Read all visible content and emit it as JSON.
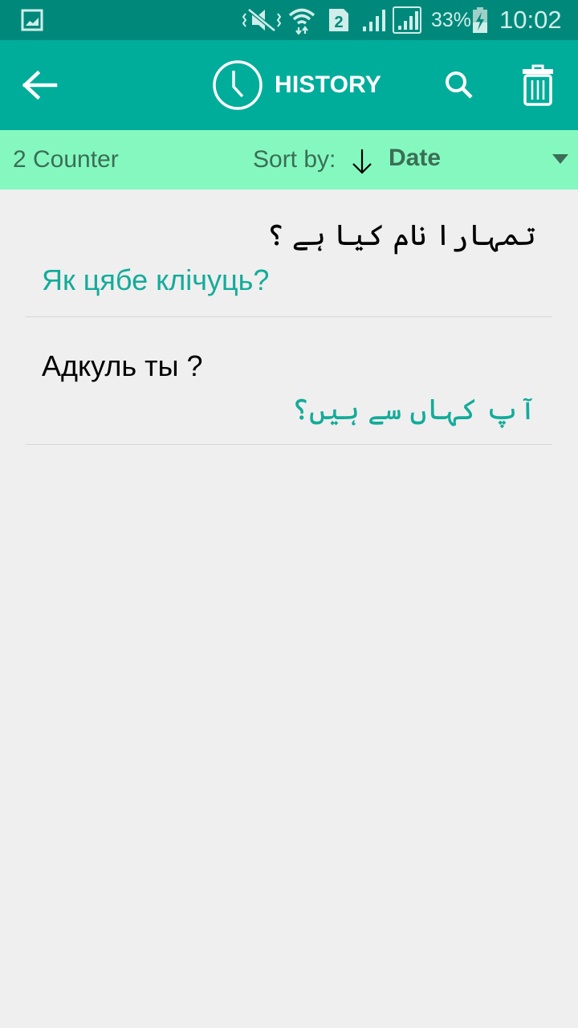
{
  "status_bar": {
    "battery": "33%",
    "time": "10:02",
    "sim": "2",
    "icons": [
      "gallery-icon",
      "vibrate-mute-icon",
      "wifi-icon",
      "sim2-icon",
      "signal-icon",
      "signal-icon",
      "battery-charging-icon"
    ]
  },
  "app_bar": {
    "title": "HISTORY",
    "back_icon": "arrow-left-icon",
    "title_icon": "clock-icon",
    "search_icon": "search-icon",
    "delete_icon": "trash-icon"
  },
  "sort_bar": {
    "counter": "2 Counter",
    "sort_label": "Sort by:",
    "sort_value": "Date",
    "sort_direction_icon": "arrow-down-icon"
  },
  "history": [
    {
      "source": "تمہارا نام کیا ہے ؟",
      "translation": "Як цябе клічуць?"
    },
    {
      "source": "Адкуль ты ?",
      "translation": "آپ کہاں سے ہیں؟"
    }
  ],
  "colors": {
    "status_bar": "#00897b",
    "app_bar": "#00ad9a",
    "sort_bar": "#85f8c0",
    "accent_text": "#14ab9a"
  }
}
